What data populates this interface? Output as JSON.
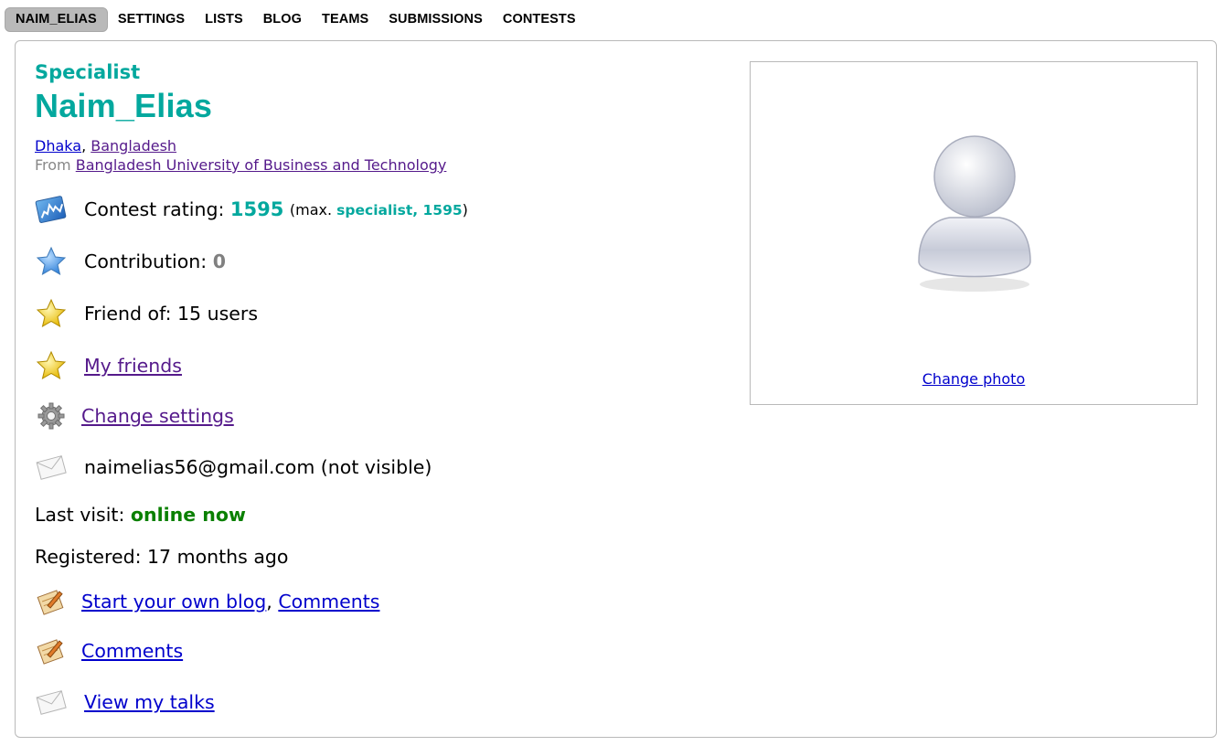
{
  "nav": {
    "tabs": [
      {
        "label": "NAIM_ELIAS",
        "active": true
      },
      {
        "label": "SETTINGS",
        "active": false
      },
      {
        "label": "LISTS",
        "active": false
      },
      {
        "label": "BLOG",
        "active": false
      },
      {
        "label": "TEAMS",
        "active": false
      },
      {
        "label": "SUBMISSIONS",
        "active": false
      },
      {
        "label": "CONTESTS",
        "active": false
      }
    ]
  },
  "profile": {
    "rank": "Specialist",
    "handle": "Naim_Elias",
    "city": "Dhaka",
    "country": "Bangladesh",
    "from_label": "From",
    "organization": "Bangladesh University of Business and Technology",
    "rating_label": "Contest rating:",
    "rating": "1595",
    "max_prefix": "(max.",
    "max_value": "specialist, 1595",
    "max_suffix": ")",
    "contribution_label": "Contribution:",
    "contribution": "0",
    "friend_of": "Friend of: 15 users",
    "my_friends": "My friends",
    "change_settings": "Change settings",
    "email": "naimelias56@gmail.com (not visible)",
    "last_visit_label": "Last visit:",
    "last_visit": "online now",
    "registered": "Registered: 17 months ago",
    "blog_link": "Start your own blog",
    "comments_link": "Comments",
    "comments_link2": "Comments",
    "talks_link": "View my talks"
  },
  "photo": {
    "change_label": "Change photo"
  },
  "colors": {
    "specialist": "#03a89e",
    "online": "#0a8000",
    "visited_link": "#551a8b",
    "link": "#0000cc"
  },
  "icons": [
    "rating-chart-icon",
    "blue-star-icon",
    "gold-star-icon",
    "gear-icon",
    "envelope-icon",
    "blog-note-icon",
    "avatar-placeholder-icon"
  ]
}
